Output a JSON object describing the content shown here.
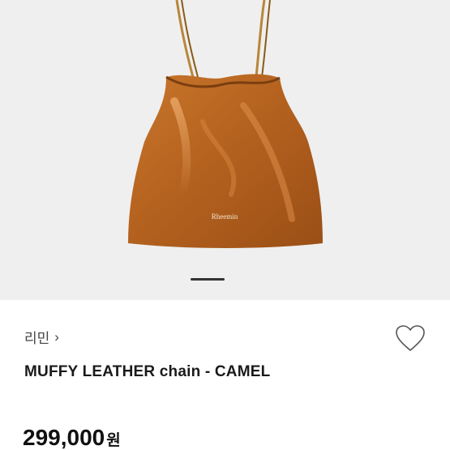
{
  "product_image": {
    "brand_stamp": "Rheemin",
    "description_icon": "bag-photo",
    "bag_color": "#b5621f"
  },
  "gallery": {
    "active_indicator": 1
  },
  "info": {
    "brand_name": "리민",
    "brand_chevron": "›",
    "title": "MUFFY LEATHER chain - CAMEL",
    "price": "299,000",
    "currency": "원",
    "wishlist_icon": "heart-outline-icon"
  }
}
